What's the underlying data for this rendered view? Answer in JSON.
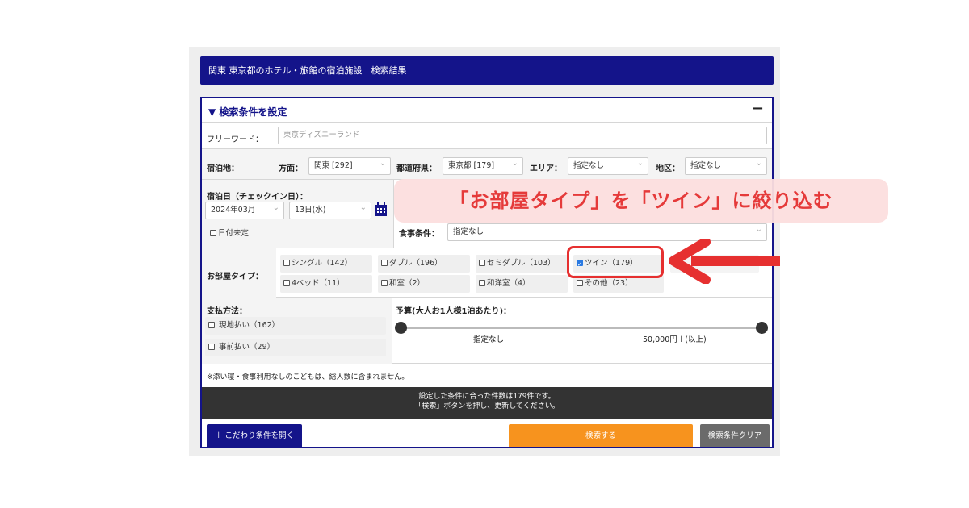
{
  "header": {
    "title": "関東 東京都のホテル・旅館の宿泊施設　検索結果"
  },
  "conditions": {
    "title": "▼ 検索条件を設定",
    "collapse_label": "−"
  },
  "freeword": {
    "label": "フリーワード：",
    "placeholder": "東京ディズニーランド"
  },
  "location": {
    "label": "宿泊地：",
    "direction_label": "方面：",
    "direction_value": "関東 [292]",
    "prefecture_label": "都道府県：",
    "prefecture_value": "東京都 [179]",
    "area_label": "エリア：",
    "area_value": "指定なし",
    "district_label": "地区：",
    "district_value": "指定なし"
  },
  "stay_date": {
    "label": "宿泊日（チェックイン日）：",
    "month_value": "2024年03月",
    "day_value": "13日(水)",
    "undecided_label": "日付未定",
    "calendar_icon": "calendar-icon"
  },
  "meal": {
    "label": "食事条件：",
    "value": "指定なし"
  },
  "room_type": {
    "label": "お部屋タイプ：",
    "options": [
      {
        "label": "シングル（142）",
        "checked": false
      },
      {
        "label": "ダブル（196）",
        "checked": false
      },
      {
        "label": "セミダブル（103）",
        "checked": false
      },
      {
        "label": "ツイン（179）",
        "checked": true
      },
      {
        "label": "4ベッド（11）",
        "checked": false
      },
      {
        "label": "和室（2）",
        "checked": false
      },
      {
        "label": "和洋室（4）",
        "checked": false
      },
      {
        "label": "その他（23）",
        "checked": false
      }
    ]
  },
  "payment": {
    "label": "支払方法：",
    "options": [
      {
        "label": "現地払い（162）",
        "checked": false
      },
      {
        "label": "事前払い（29）",
        "checked": false
      }
    ]
  },
  "budget": {
    "label": "予算(大人お1人様1泊あたり)：",
    "min_label": "指定なし",
    "max_label": "50,000円＋(以上)"
  },
  "note": "※添い寝・食事利用なしのこどもは、総人数に含まれません。",
  "result": {
    "line1": "設定した条件に合った件数は179件です。",
    "line2": "「検索」ボタンを押し、更新してください。"
  },
  "buttons": {
    "more_conditions": "＋ こだわり条件を開く",
    "search": "検索する",
    "clear": "検索条件クリア"
  },
  "annotation": {
    "text": "「お部屋タイプ」を「ツイン」に絞り込む",
    "color": "#e53a3a"
  },
  "colors": {
    "brand": "#14148a",
    "search_button": "#f7931e",
    "clear_button": "#6b6b6b",
    "highlight": "#e63030"
  }
}
